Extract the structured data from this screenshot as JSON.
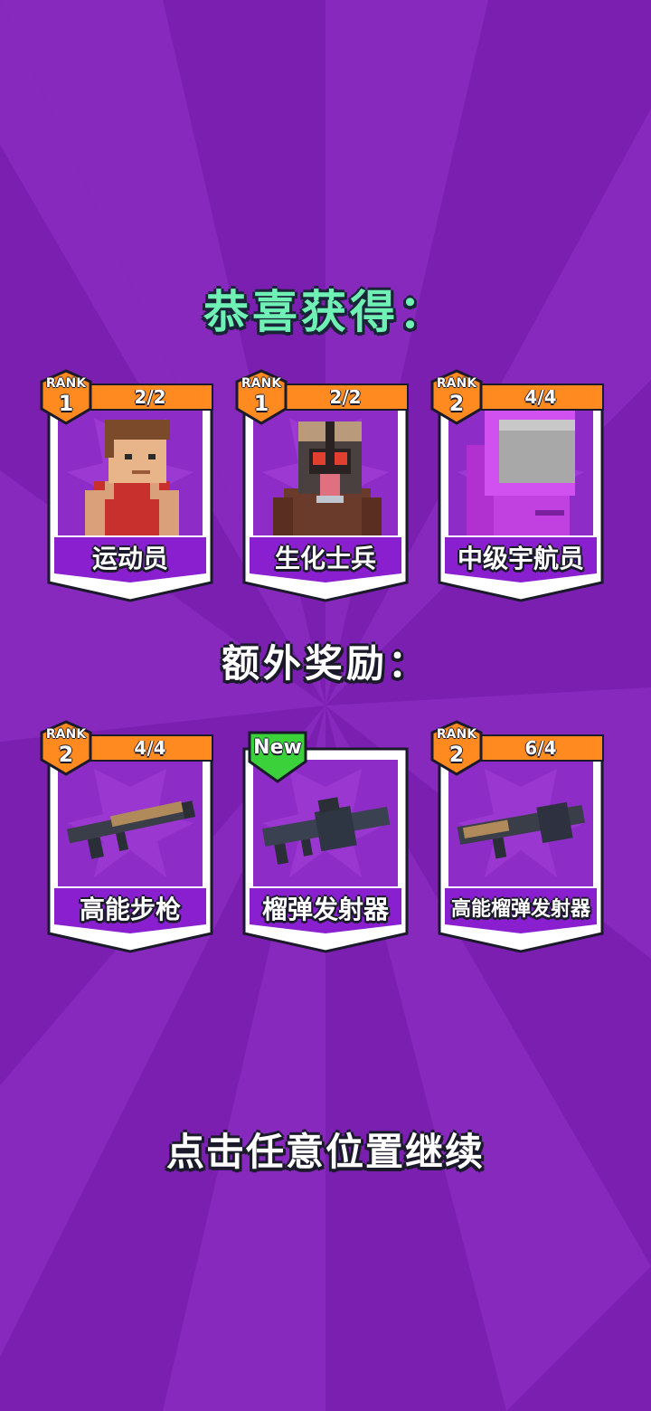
{
  "title": "恭喜获得：",
  "subtitle": "额外奖励：",
  "continue_text": "点击任意位置继续",
  "colors": {
    "background": "#7a1fb0",
    "title": "#6ff0b4",
    "card_panel": "#8e2cc8",
    "name_bar": "#8a1fd0",
    "progress_bar": "#ff8a1f",
    "rank_badge": "#ff8a1f",
    "new_badge": "#3bd13b"
  },
  "characters": [
    {
      "rank_label": "RANK",
      "rank": "1",
      "progress": "2/2",
      "name": "运动员",
      "art": "athlete-figure"
    },
    {
      "rank_label": "RANK",
      "rank": "1",
      "progress": "2/2",
      "name": "生化士兵",
      "art": "bio-soldier-figure"
    },
    {
      "rank_label": "RANK",
      "rank": "2",
      "progress": "4/4",
      "name": "中级宇航员",
      "art": "astronaut-figure"
    }
  ],
  "weapons": [
    {
      "rank_label": "RANK",
      "rank": "2",
      "progress": "4/4",
      "name": "高能步枪",
      "art": "rifle-icon"
    },
    {
      "badge": "New",
      "name": "榴弹发射器",
      "art": "grenade-launcher-icon"
    },
    {
      "rank_label": "RANK",
      "rank": "2",
      "progress": "6/4",
      "name": "高能榴弹发射器",
      "art": "energy-grenade-launcher-icon"
    }
  ]
}
